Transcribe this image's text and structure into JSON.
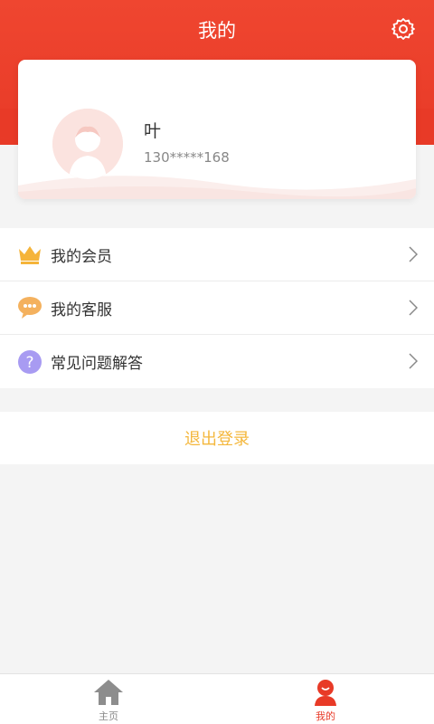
{
  "header": {
    "title": "我的",
    "settings_icon": "gear-icon"
  },
  "profile": {
    "name": "叶",
    "phone": "130*****168",
    "avatar_icon": "user-avatar-icon"
  },
  "menu": {
    "items": [
      {
        "label": "我的会员",
        "icon": "crown-icon"
      },
      {
        "label": "我的客服",
        "icon": "chat-bubble-icon"
      },
      {
        "label": "常见问题解答",
        "icon": "question-icon"
      }
    ]
  },
  "logout": {
    "label": "退出登录"
  },
  "tabbar": {
    "tabs": [
      {
        "label": "主页",
        "icon": "home-icon",
        "active": false
      },
      {
        "label": "我的",
        "icon": "person-icon",
        "active": true
      }
    ]
  },
  "colors": {
    "brand_red": "#e83a27",
    "accent_yellow": "#f4b73c",
    "inactive_gray": "#888888"
  }
}
